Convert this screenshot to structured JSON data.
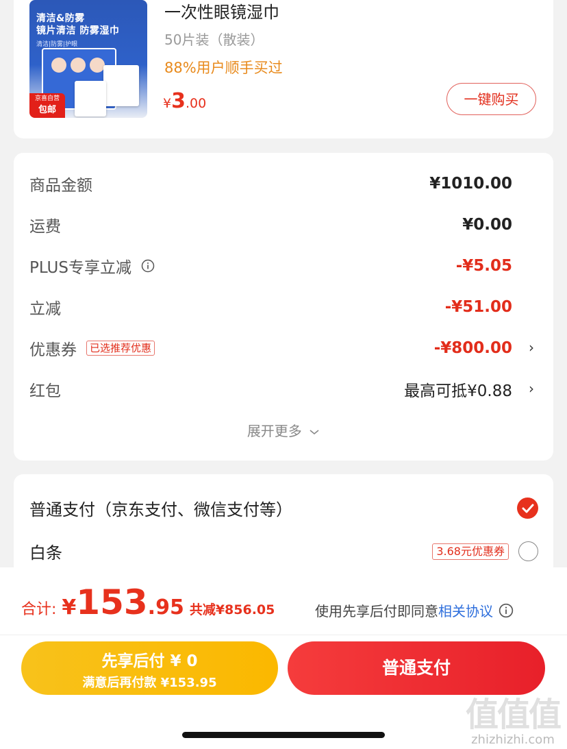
{
  "product": {
    "title": "一次性眼镜湿巾",
    "spec": "50片装（散装）",
    "sold": "88%用户顺手买过",
    "price_symbol": "¥",
    "price_int": "3",
    "price_dec": ".00",
    "buy_label": "一键购买",
    "image": {
      "line1": "清洁&防雾",
      "line2": "镜片清洁 防雾湿巾",
      "line3": "清洁|防雾|护眼",
      "badge_top": "京喜自营",
      "badge_bottom": "包邮"
    }
  },
  "summary": {
    "rows": [
      {
        "label": "商品金额",
        "value": "¥1010.00"
      },
      {
        "label": "运费",
        "value": "¥0.00"
      },
      {
        "label": "PLUS专享立减",
        "value": "-¥5.05"
      },
      {
        "label": "立减",
        "value": "-¥51.00"
      },
      {
        "label": "优惠券",
        "tag": "已选推荐优惠",
        "value": "-¥800.00"
      },
      {
        "label": "红包",
        "value": "最高可抵¥0.88"
      }
    ],
    "expand_label": "展开更多"
  },
  "payment": {
    "options": [
      {
        "label": "普通支付（京东支付、微信支付等）",
        "selected": true
      },
      {
        "label": "白条",
        "tag": "3.68元优惠券",
        "selected": false
      }
    ]
  },
  "checkout": {
    "total_label": "合计:",
    "currency": "¥",
    "total_int": "153",
    "total_dec": ".95",
    "saved": "共减¥856.05",
    "agree_text": "使用先享后付即同意",
    "agree_link": "相关协议",
    "later_line1": "先享后付 ¥ 0",
    "later_line2": "满意后再付款 ¥153.95",
    "pay_label": "普通支付"
  },
  "watermark": {
    "big": "值值值",
    "small": "zhizhizhi.com"
  },
  "colors": {
    "accent_red": "#e7311d",
    "accent_yellow": "#fbb800",
    "link_blue": "#2f6fdc"
  }
}
